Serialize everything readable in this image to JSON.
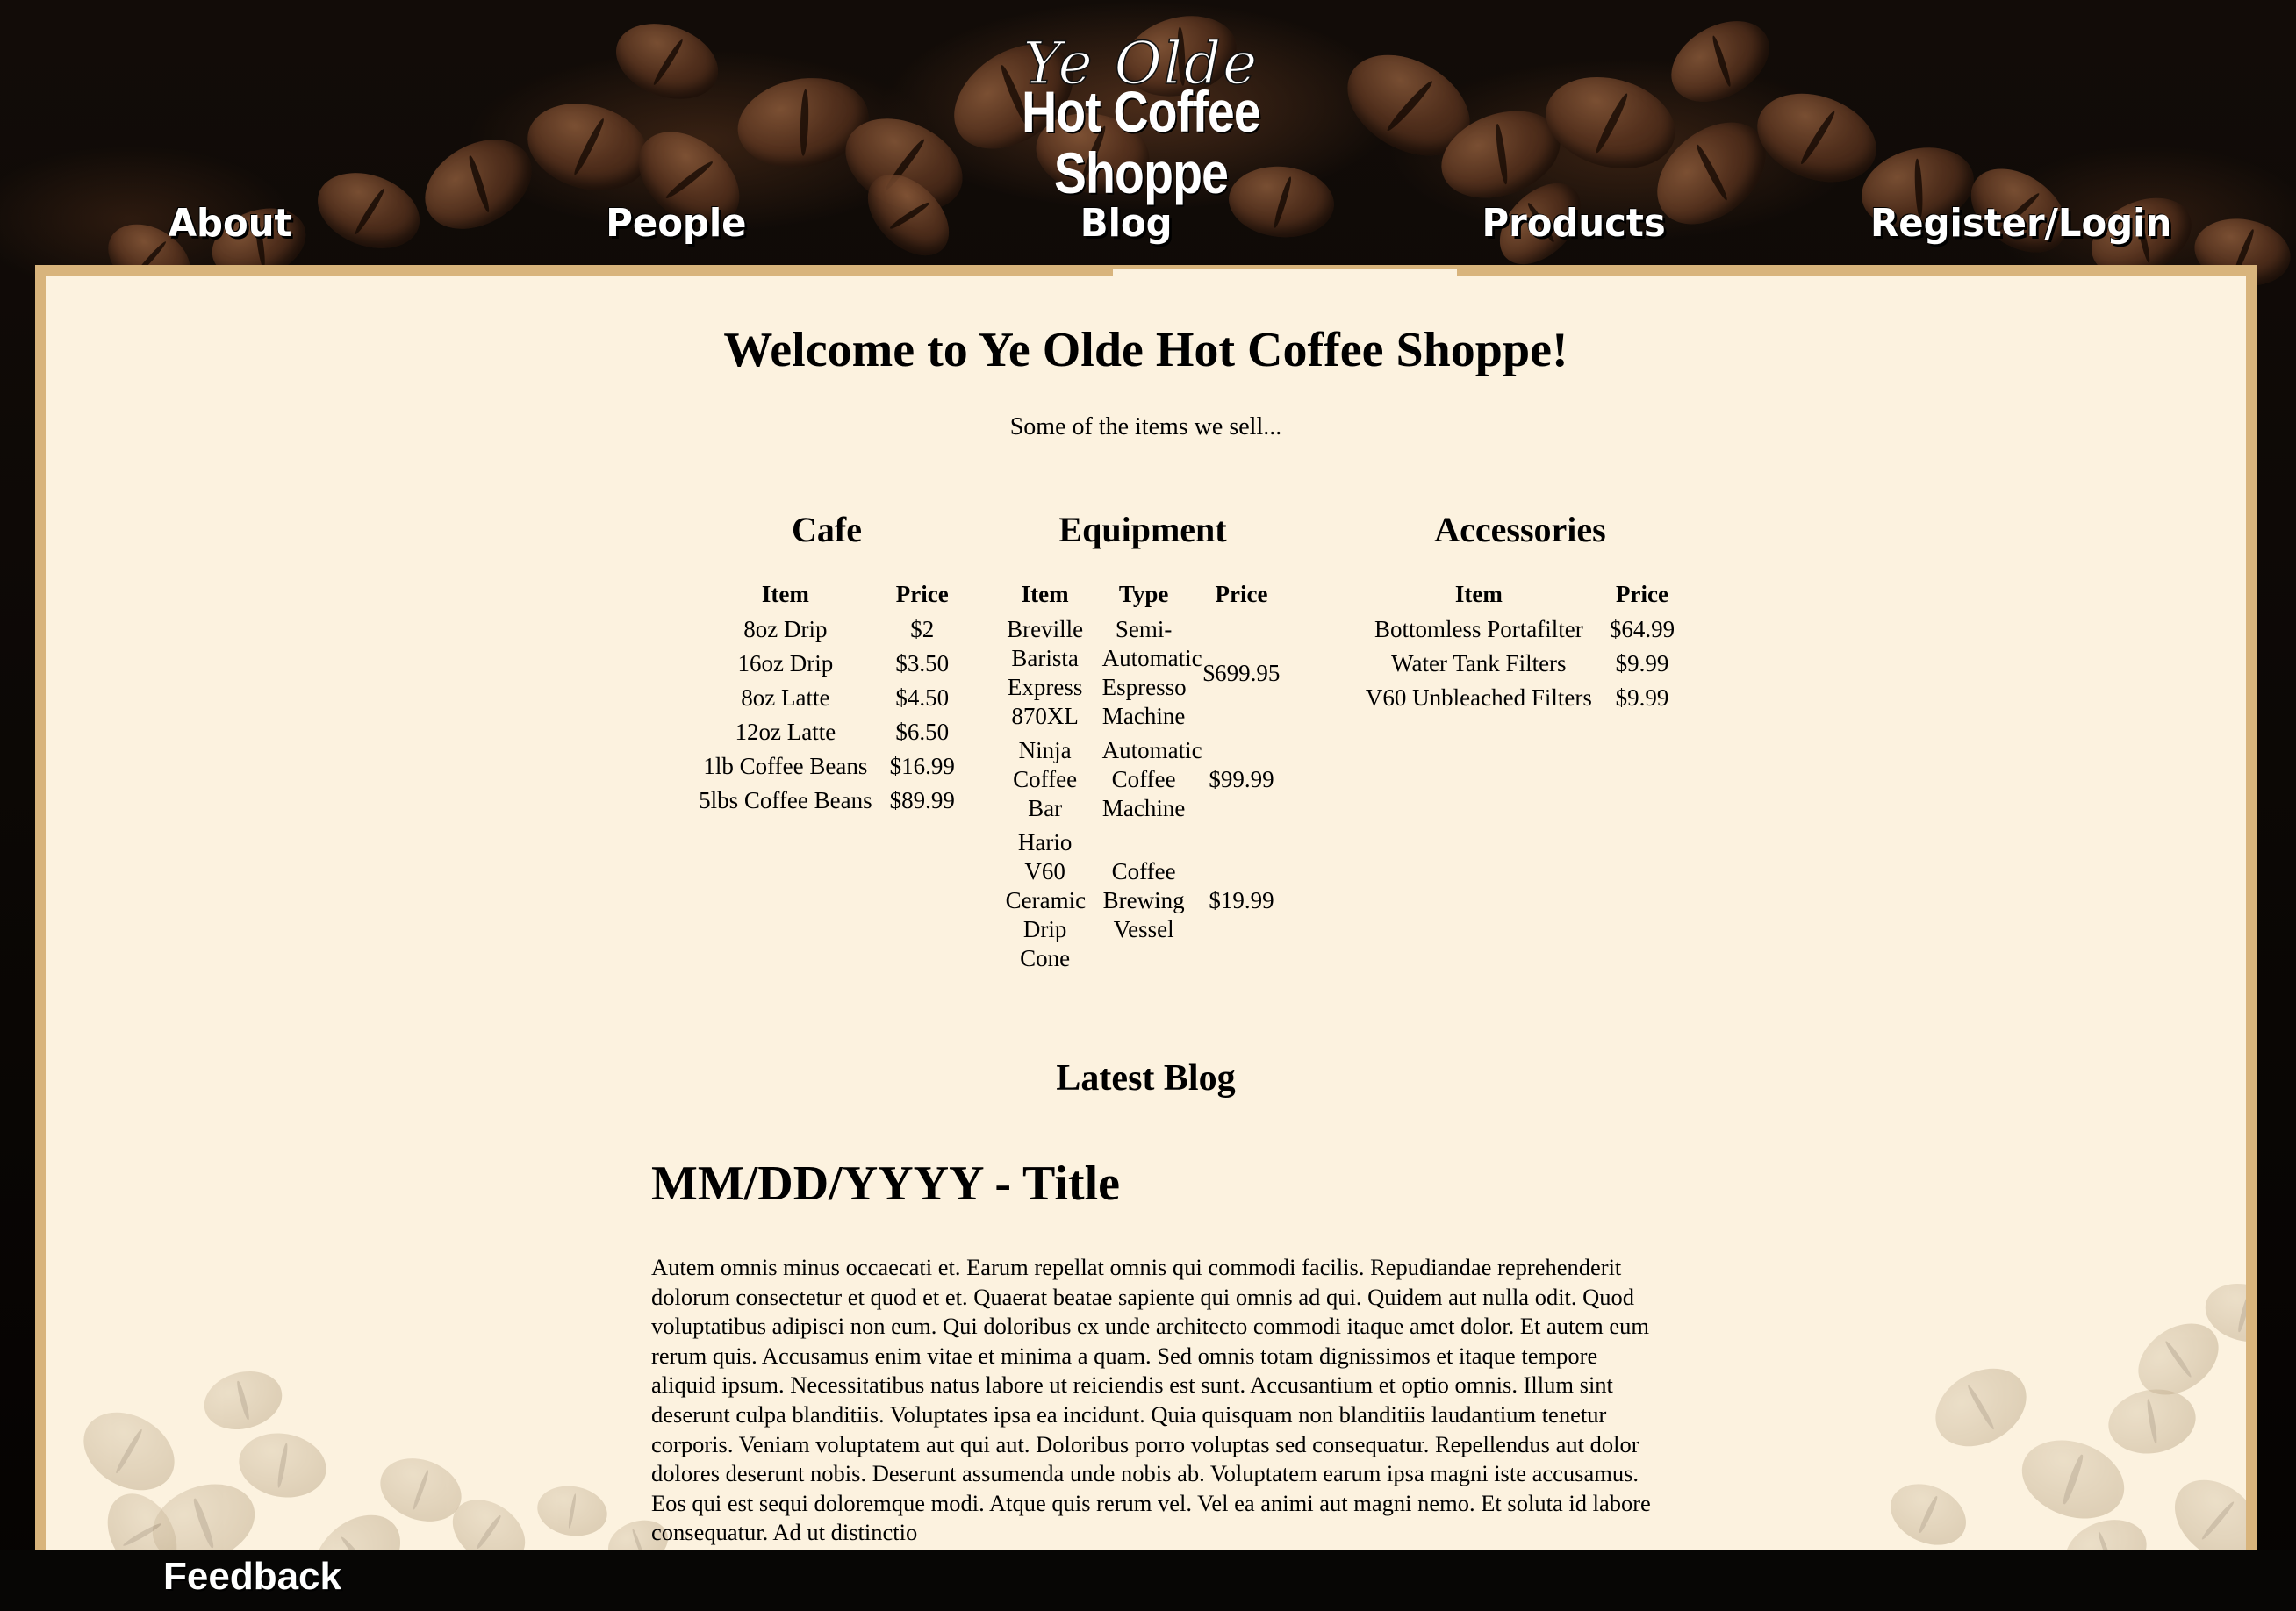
{
  "header": {
    "logo_line1": "Ye Olde",
    "logo_line2": "Hot Coffee Shoppe"
  },
  "nav": {
    "items": [
      "About",
      "People",
      "Blog",
      "Products",
      "Register/Login"
    ],
    "active": "Blog"
  },
  "main": {
    "welcome": "Welcome to Ye Olde Hot Coffee Shoppe!",
    "intro": "Some of the items we sell...",
    "cafe": {
      "title": "Cafe",
      "headers": [
        "Item",
        "Price"
      ],
      "rows": [
        [
          "8oz Drip",
          "$2"
        ],
        [
          "16oz Drip",
          "$3.50"
        ],
        [
          "8oz Latte",
          "$4.50"
        ],
        [
          "12oz Latte",
          "$6.50"
        ],
        [
          "1lb Coffee Beans",
          "$16.99"
        ],
        [
          "5lbs Coffee Beans",
          "$89.99"
        ]
      ]
    },
    "equipment": {
      "title": "Equipment",
      "headers": [
        "Item",
        "Type",
        "Price"
      ],
      "rows": [
        [
          "Breville Barista Express 870XL",
          "Semi-Automatic Espresso Machine",
          "$699.95"
        ],
        [
          "Ninja Coffee Bar",
          "Automatic Coffee Machine",
          "$99.99"
        ],
        [
          "Hario V60 Ceramic Drip Cone",
          "Coffee Brewing Vessel",
          "$19.99"
        ]
      ]
    },
    "accessories": {
      "title": "Accessories",
      "headers": [
        "Item",
        "Price"
      ],
      "rows": [
        [
          "Bottomless Portafilter",
          "$64.99"
        ],
        [
          "Water Tank Filters",
          "$9.99"
        ],
        [
          "V60 Unbleached Filters",
          "$9.99"
        ]
      ]
    },
    "latest_blog": "Latest Blog",
    "blog_title": "MM/DD/YYYY - Title",
    "blog_body": "Autem omnis minus occaecati et. Earum repellat omnis qui commodi facilis. Repudiandae reprehenderit dolorum consectetur et quod et et. Quaerat beatae sapiente qui omnis ad qui. Quidem aut nulla odit. Quod voluptatibus adipisci non eum. Qui doloribus ex unde architecto commodi itaque amet dolor. Et autem eum rerum quis. Accusamus enim vitae et minima a quam. Sed omnis totam dignissimos et itaque tempore aliquid ipsum. Necessitatibus natus labore ut reiciendis est sunt. Accusantium et optio omnis. Illum sint deserunt culpa blanditiis. Voluptates ipsa ea incidunt. Quia quisquam non blanditiis laudantium tenetur corporis. Veniam voluptatem aut qui aut. Doloribus porro voluptas sed consequatur. Repellendus aut dolor dolores deserunt nobis. Deserunt assumenda unde nobis ab. Voluptatem earum ipsa magni iste accusamus. Eos qui est sequi doloremque modi. Atque quis rerum vel. Vel ea animi aut magni nemo. Et soluta id labore consequatur. Ad ut distinctio"
  },
  "footer": {
    "feedback": "Feedback"
  },
  "colors": {
    "panel_background": "#fcf2df",
    "panel_border": "#d8b47c",
    "header_background": "#0b0806",
    "nav_text": "#ffffff"
  }
}
